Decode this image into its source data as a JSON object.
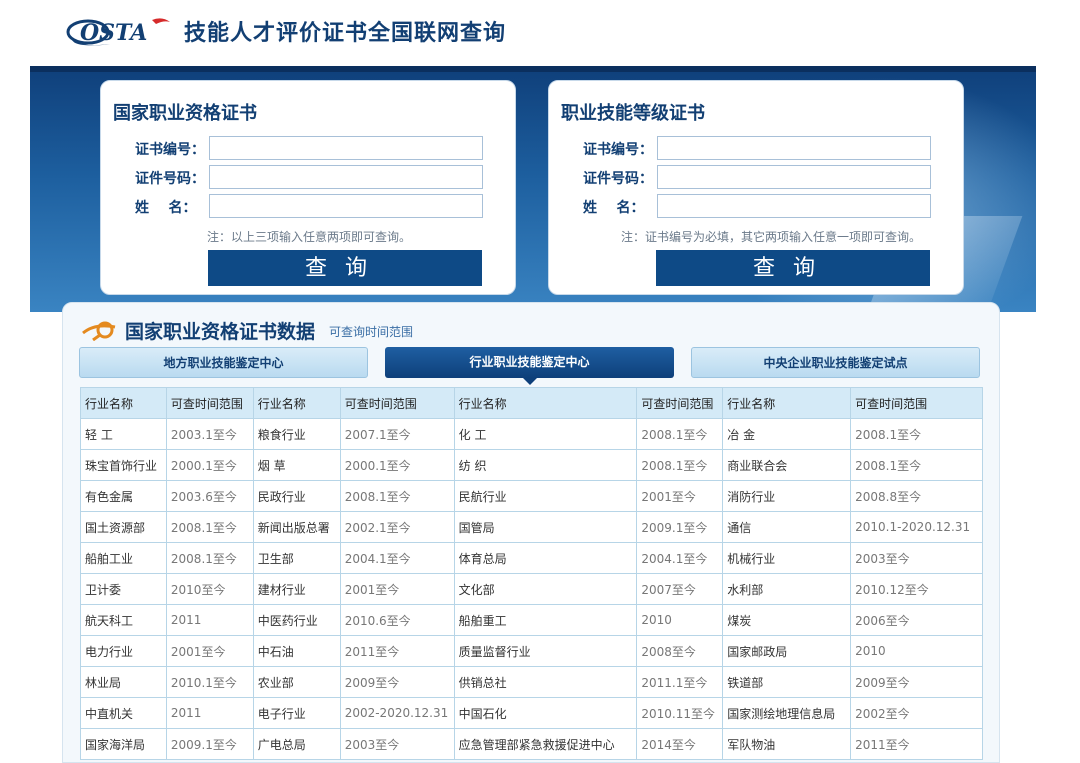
{
  "header": {
    "logo_text": "OSTA",
    "title": "技能人才评价证书全国联网查询"
  },
  "panels": {
    "left": {
      "title": "国家职业资格证书",
      "fields": {
        "cert_no_label": "证书编号：",
        "id_no_label": "证件号码：",
        "name_label": "姓    名：",
        "cert_no_value": "",
        "id_no_value": "",
        "name_value": ""
      },
      "note": "注：以上三项输入任意两项即可查询。",
      "button": "查询"
    },
    "right": {
      "title": "职业技能等级证书",
      "fields": {
        "cert_no_label": "证书编号：",
        "id_no_label": "证件号码：",
        "name_label": "姓    名：",
        "cert_no_value": "",
        "id_no_value": "",
        "name_value": ""
      },
      "note": "注：证书编号为必填，其它两项输入任意一项即可查询。",
      "button": "查询"
    }
  },
  "data_section": {
    "title": "国家职业资格证书数据",
    "subtitle": "可查询时间范围",
    "tabs": [
      {
        "label": "地方职业技能鉴定中心",
        "active": false
      },
      {
        "label": "行业职业技能鉴定中心",
        "active": true
      },
      {
        "label": "中央企业职业技能鉴定试点",
        "active": false
      }
    ],
    "table": {
      "headers": [
        "行业名称",
        "可查时间范围",
        "行业名称",
        "可查时间范围",
        "行业名称",
        "可查时间范围",
        "行业名称",
        "可查时间范围"
      ],
      "rows": [
        [
          "轻 工",
          "2003.1至今",
          "粮食行业",
          "2007.1至今",
          "化 工",
          "2008.1至今",
          "冶 金",
          "2008.1至今"
        ],
        [
          "珠宝首饰行业",
          "2000.1至今",
          "烟 草",
          "2000.1至今",
          "纺 织",
          "2008.1至今",
          "商业联合会",
          "2008.1至今"
        ],
        [
          "有色金属",
          "2003.6至今",
          "民政行业",
          "2008.1至今",
          "民航行业",
          "2001至今",
          "消防行业",
          "2008.8至今"
        ],
        [
          "国土资源部",
          "2008.1至今",
          "新闻出版总署",
          "2002.1至今",
          "国管局",
          "2009.1至今",
          "通信",
          "2010.1-2020.12.31"
        ],
        [
          "船舶工业",
          "2008.1至今",
          "卫生部",
          "2004.1至今",
          "体育总局",
          "2004.1至今",
          "机械行业",
          "2003至今"
        ],
        [
          "卫计委",
          "2010至今",
          "建材行业",
          "2001至今",
          "文化部",
          "2007至今",
          "水利部",
          "2010.12至今"
        ],
        [
          "航天科工",
          "2011",
          "中医药行业",
          "2010.6至今",
          "船舶重工",
          "2010",
          "煤炭",
          "2006至今"
        ],
        [
          "电力行业",
          "2001至今",
          "中石油",
          "2011至今",
          "质量监督行业",
          "2008至今",
          "国家邮政局",
          "2010"
        ],
        [
          "林业局",
          "2010.1至今",
          "农业部",
          "2009至今",
          "供销总社",
          "2011.1至今",
          "铁道部",
          "2009至今"
        ],
        [
          "中直机关",
          "2011",
          "电子行业",
          "2002-2020.12.31",
          "中国石化",
          "2010.11至今",
          "国家测绘地理信息局",
          "2002至今"
        ],
        [
          "国家海洋局",
          "2009.1至今",
          "广电总局",
          "2003至今",
          "应急管理部紧急救援促进中心",
          "2014至今",
          "军队物油",
          "2011至今"
        ]
      ]
    }
  }
}
